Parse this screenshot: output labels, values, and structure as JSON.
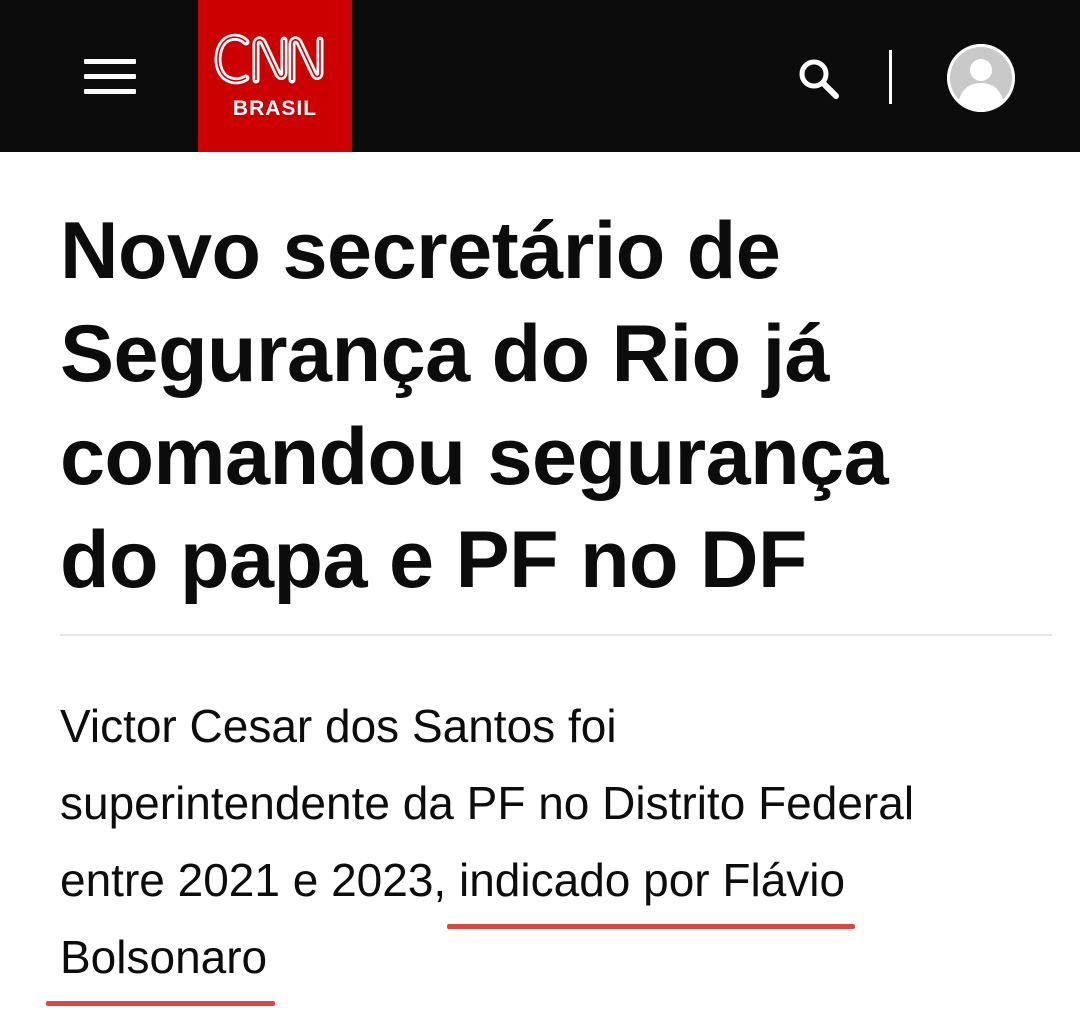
{
  "header": {
    "menu_icon": "hamburger-menu-icon",
    "logo": {
      "brand": "CNN",
      "sub": "BRASIL",
      "bg_color": "#cc0000"
    },
    "search_icon": "search-icon",
    "avatar_icon": "user-avatar-icon",
    "bg_color": "#0c0c0c"
  },
  "article": {
    "headline_lines": [
      "Novo secretário de",
      "Segurança do Rio já",
      "comandou segurança",
      "do papa e PF no DF"
    ],
    "subhead": {
      "line1": "Victor Cesar dos Santos foi",
      "line2": "superintendente da PF no Distrito Federal",
      "line3_plain": "entre 2021 e 2023, ",
      "line3_marked": "indicado por Flávio",
      "line4_marked": "Bolsonaro"
    },
    "highlight_color": "#e0463f"
  }
}
